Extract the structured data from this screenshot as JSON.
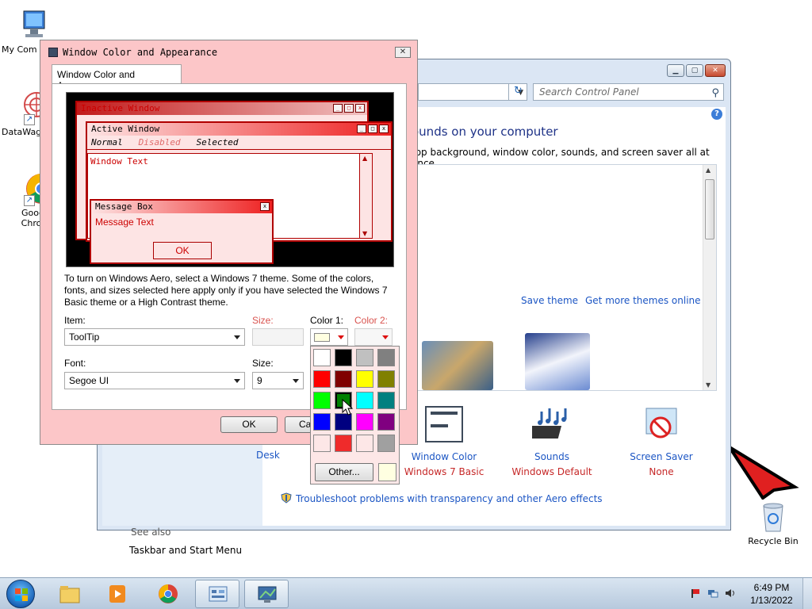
{
  "desktop": {
    "icons": [
      {
        "label": "My Com"
      },
      {
        "label": "DataWag"
      },
      {
        "label": "Googl Chron"
      },
      {
        "label": "Recycle Bin"
      }
    ]
  },
  "control_panel": {
    "search_placeholder": "Search Control Panel",
    "heading": "ounds on your computer",
    "subheading": "top background, window color, sounds, and screen saver all at once.",
    "save_theme": "Save theme",
    "get_more_themes": "Get more themes online",
    "bottom_items": [
      {
        "title": "Desk",
        "value": ""
      },
      {
        "title": "Window Color",
        "value": "Windows 7 Basic"
      },
      {
        "title": "Sounds",
        "value": "Windows Default"
      },
      {
        "title": "Screen Saver",
        "value": "None"
      }
    ],
    "see_also": "See also",
    "taskbar_link": "Taskbar and Start Menu",
    "troubleshoot": "Troubleshoot problems with transparency and other Aero effects"
  },
  "dialog": {
    "title": "Window Color and Appearance",
    "tab": "Window Color and Appearance",
    "preview": {
      "inactive_window": "Inactive Window",
      "active_window": "Active Window",
      "menu_normal": "Normal",
      "menu_disabled": "Disabled",
      "menu_selected": "Selected",
      "window_text": "Window Text",
      "message_box": "Message Box",
      "message_text": "Message Text",
      "ok": "OK"
    },
    "description": "To turn on Windows Aero, select a Windows 7 theme.  Some of the colors, fonts, and sizes selected here apply only if you have selected the Windows 7 Basic theme or a High Contrast theme.",
    "item_label": "Item:",
    "item_value": "ToolTip",
    "size_label": "Size:",
    "color1_label": "Color 1:",
    "color2_label": "Color 2:",
    "font_label": "Font:",
    "font_value": "Segoe UI",
    "font_size_label": "Size:",
    "font_size_value": "9",
    "ok_button": "OK",
    "cancel_button": "Ca",
    "color1_value": "#ffffe1"
  },
  "color_picker": {
    "swatches": [
      "#ffffff",
      "#000000",
      "#c0c0c0",
      "#808080",
      "#ff0000",
      "#800000",
      "#ffff00",
      "#808000",
      "#00ff00",
      "#008000",
      "#00ffff",
      "#008080",
      "#0000ff",
      "#000080",
      "#ff00ff",
      "#800080",
      "#fde7e7",
      "#ef2b2b",
      "#fde7e7",
      "#a0a0a0"
    ],
    "selected_index": 9,
    "other_button": "Other...",
    "custom_color": "#ffffe1"
  },
  "taskbar": {
    "time": "6:49 PM",
    "date": "1/13/2022"
  }
}
